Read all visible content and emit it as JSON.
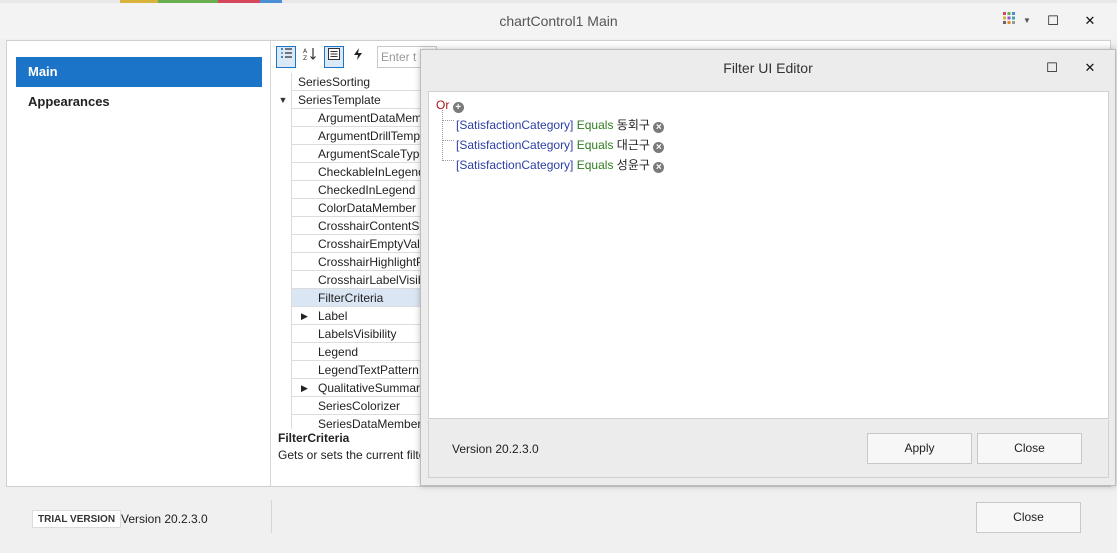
{
  "window": {
    "title": "chartControl1 Main",
    "palette_icon": "palette-icon",
    "dropdown_icon": "chevron-down-icon",
    "maximize_glyph": "☐",
    "close_glyph": "✕"
  },
  "sidebar": {
    "items": [
      {
        "label": "Main",
        "active": true
      },
      {
        "label": "Appearances",
        "active": false
      }
    ]
  },
  "property_grid": {
    "toolbar": {
      "categorized_icon": "categorized-icon",
      "alphabetical_icon": "sort-alpha-icon",
      "properties_icon": "properties-icon",
      "events_icon": "lightning-icon"
    },
    "search_placeholder": "Enter t",
    "rows": [
      {
        "label": "SeriesSorting"
      },
      {
        "label": "SeriesTemplate",
        "expander": "▼"
      },
      {
        "label": "ArgumentDataMember"
      },
      {
        "label": "ArgumentDrillTemplate"
      },
      {
        "label": "ArgumentScaleType"
      },
      {
        "label": "CheckableInLegend"
      },
      {
        "label": "CheckedInLegend"
      },
      {
        "label": "ColorDataMember"
      },
      {
        "label": "CrosshairContentShowMode"
      },
      {
        "label": "CrosshairEmptyValueLegendText"
      },
      {
        "label": "CrosshairHighlightPoints"
      },
      {
        "label": "CrosshairLabelVisibility"
      },
      {
        "label": "FilterCriteria",
        "selected": true
      },
      {
        "label": "Label",
        "expander": "▶"
      },
      {
        "label": "LabelsVisibility"
      },
      {
        "label": "Legend"
      },
      {
        "label": "LegendTextPattern"
      },
      {
        "label": "QualitativeSummaryOptions",
        "expander": "▶"
      },
      {
        "label": "SeriesColorizer"
      },
      {
        "label": "SeriesDataMember"
      }
    ],
    "description_title": "FilterCriteria",
    "description_text": "Gets or sets the current filter criteria"
  },
  "footer": {
    "trial_badge": "TRIAL VERSION",
    "version": "Version 20.2.3.0",
    "close_label": "Close"
  },
  "filter_dialog": {
    "title": "Filter UI Editor",
    "group_operator": "Or",
    "add_icon": "plus-circle-icon",
    "remove_icon": "remove-circle-icon",
    "conditions": [
      {
        "field": "[SatisfactionCategory]",
        "operator": "Equals",
        "value": "동회구"
      },
      {
        "field": "[SatisfactionCategory]",
        "operator": "Equals",
        "value": "대근구"
      },
      {
        "field": "[SatisfactionCategory]",
        "operator": "Equals",
        "value": "성윤구"
      }
    ],
    "version": "Version 20.2.3.0",
    "apply_label": "Apply",
    "close_label": "Close"
  },
  "colors": {
    "accent": "#1b74c8",
    "field": "#2b3fa6",
    "operator": "#2e7d1e",
    "group": "#a31515"
  }
}
